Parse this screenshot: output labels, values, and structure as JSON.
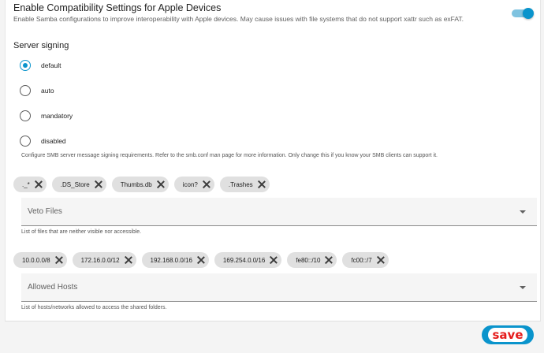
{
  "compat": {
    "title": "Enable Compatibility Settings for Apple Devices",
    "description": "Enable Samba configurations to improve interoperability with Apple devices. May cause issues with file systems that do not support xattr such as exFAT.",
    "enabled": true
  },
  "signing": {
    "title": "Server signing",
    "options": [
      {
        "label": "default",
        "selected": true
      },
      {
        "label": "auto",
        "selected": false
      },
      {
        "label": "mandatory",
        "selected": false
      },
      {
        "label": "disabled",
        "selected": false
      }
    ],
    "help": "Configure SMB server message signing requirements. Refer to the smb.conf man page for more information. Only change this if you know your SMB clients can support it."
  },
  "veto": {
    "chips": [
      "._*",
      ".DS_Store",
      "Thumbs.db",
      "icon?",
      ".Trashes"
    ],
    "label": "Veto Files",
    "help": "List of files that are neither visible nor accessible."
  },
  "hosts": {
    "chips": [
      "10.0.0.0/8",
      "172.16.0.0/12",
      "192.168.0.0/16",
      "169.254.0.0/16",
      "fe80::/10",
      "fc00::/7"
    ],
    "label": "Allowed Hosts",
    "help": "List of hosts/networks allowed to access the shared folders."
  },
  "save_label": "save",
  "colors": {
    "accent": "#0a94cc",
    "save_text": "#e51c1c"
  }
}
